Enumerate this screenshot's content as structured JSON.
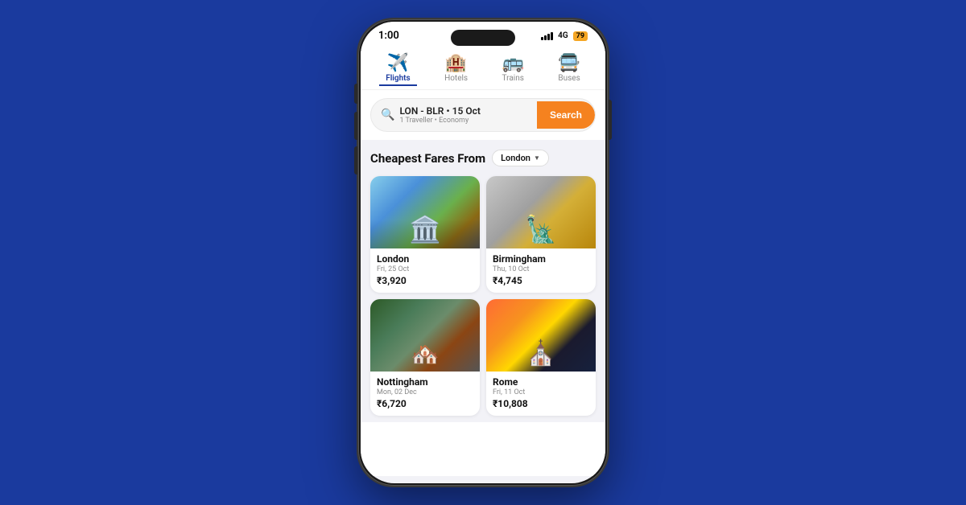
{
  "status": {
    "time": "1:00",
    "network": "4G",
    "battery": "79"
  },
  "nav": {
    "tabs": [
      {
        "id": "flights",
        "label": "Flights",
        "icon": "✈️",
        "active": true
      },
      {
        "id": "hotels",
        "label": "Hotels",
        "icon": "🏨",
        "active": false
      },
      {
        "id": "trains",
        "label": "Trains",
        "icon": "🚌",
        "active": false
      },
      {
        "id": "buses",
        "label": "Buses",
        "icon": "🚍",
        "active": false
      }
    ]
  },
  "search_bar": {
    "route": "LON - BLR • 15 Oct",
    "details": "1 Traveller • Economy",
    "button_label": "Search"
  },
  "fares_section": {
    "title": "Cheapest Fares From",
    "location": "London",
    "destinations": [
      {
        "city": "London",
        "date": "Fri, 25 Oct",
        "price": "₹3,920",
        "img_class": "img-london"
      },
      {
        "city": "Birmingham",
        "date": "Thu, 10 Oct",
        "price": "₹4,745",
        "img_class": "img-birmingham"
      },
      {
        "city": "Nottingham",
        "date": "Mon, 02 Dec",
        "price": "₹6,720",
        "img_class": "img-nottingham"
      },
      {
        "city": "Rome",
        "date": "Fri, 11 Oct",
        "price": "₹10,808",
        "img_class": "img-rome"
      }
    ]
  }
}
